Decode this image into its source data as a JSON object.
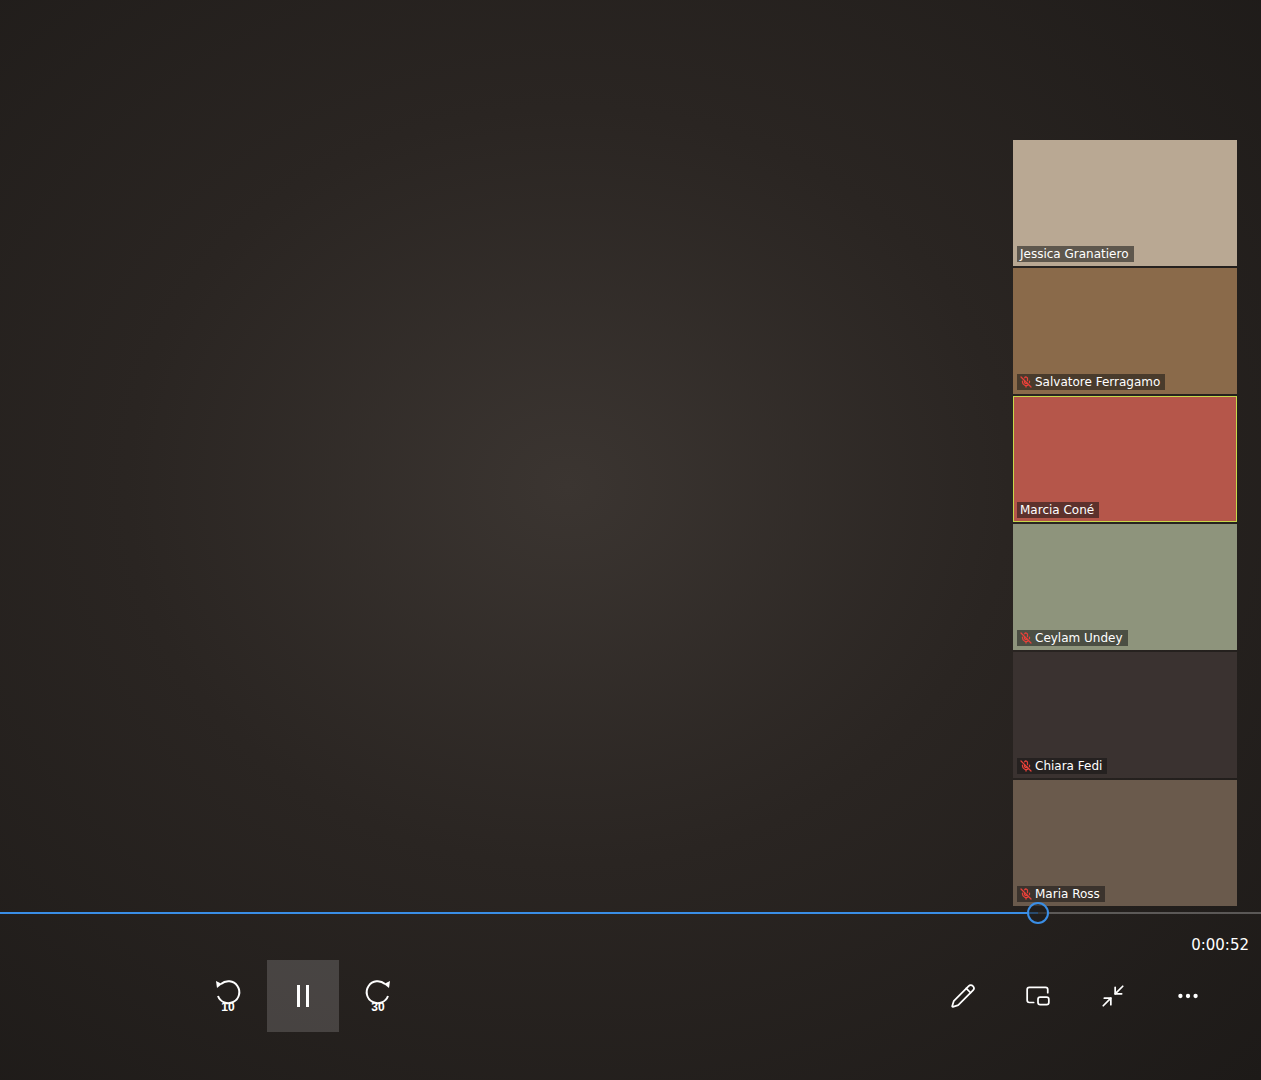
{
  "player": {
    "time": "0:00:52",
    "level": 0.823,
    "playing": true,
    "skip_back": "10",
    "skip_forward": "30"
  },
  "participants": [
    {
      "name": "Jessica Granatiero",
      "muted": false,
      "selected": false,
      "color": "#b9a893"
    },
    {
      "name": "Salvatore Ferragamo",
      "muted": true,
      "selected": false,
      "color": "#8a6a4a"
    },
    {
      "name": "Marcia Coné",
      "muted": false,
      "selected": true,
      "color": "#b5564a"
    },
    {
      "name": "Ceylam Undey",
      "muted": true,
      "selected": false,
      "color": "#8e947c"
    },
    {
      "name": "Chiara Fedi",
      "muted": true,
      "selected": false,
      "color": "#3a3230"
    },
    {
      "name": "Maria Ross",
      "muted": true,
      "selected": false,
      "color": "#6a5a4c"
    }
  ]
}
